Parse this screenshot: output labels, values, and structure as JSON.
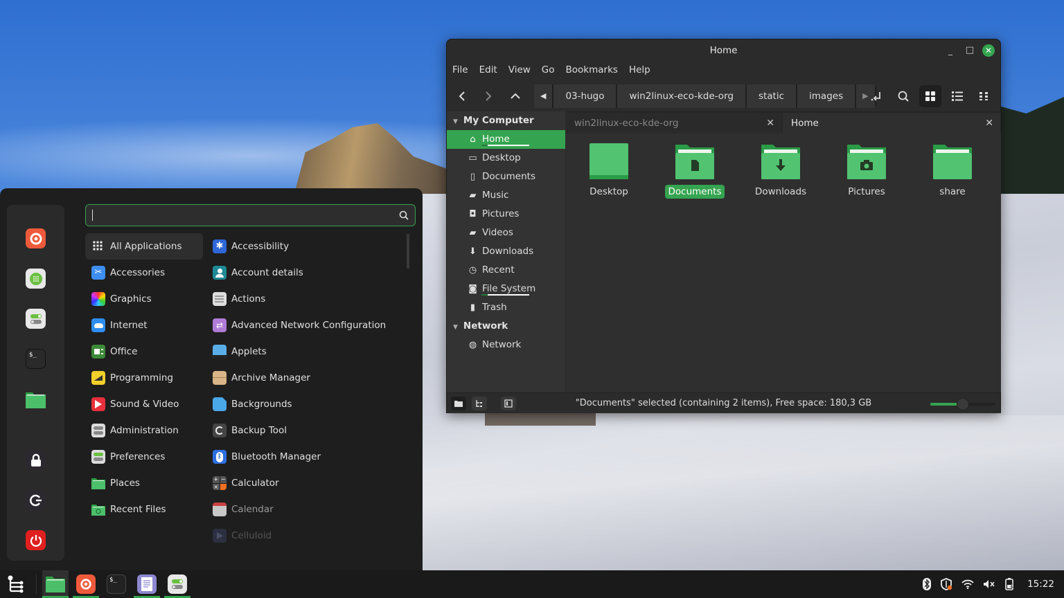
{
  "start_menu": {
    "search": {
      "value": "",
      "placeholder": ""
    },
    "favorites": [
      {
        "name": "firefox",
        "color": "#ee5a3b"
      },
      {
        "name": "software-manager",
        "color": "#e8e8e8"
      },
      {
        "name": "system-settings",
        "color": "#e8e8e8"
      },
      {
        "name": "terminal",
        "color": "#2a2a2a"
      },
      {
        "name": "files",
        "color": "#4cbf6a"
      },
      {
        "name": "lock-screen",
        "color": "#2b2830"
      },
      {
        "name": "logout",
        "color": "#2b2830"
      },
      {
        "name": "shutdown",
        "color": "#e0201e"
      }
    ],
    "categories": [
      {
        "label": "All Applications",
        "icon": "grid-icon",
        "color": "#2e2e2e",
        "selected": true
      },
      {
        "label": "Accessories",
        "icon": "scissors-icon",
        "color": "#3d8ef0"
      },
      {
        "label": "Graphics",
        "icon": "color-palette-icon",
        "color": "#c03fd0"
      },
      {
        "label": "Internet",
        "icon": "cloud-icon",
        "color": "#2e8ef0"
      },
      {
        "label": "Office",
        "icon": "office-icon",
        "color": "#3d8a38"
      },
      {
        "label": "Programming",
        "icon": "ruler-icon",
        "color": "#f2cf2a"
      },
      {
        "label": "Sound & Video",
        "icon": "play-icon",
        "color": "#e8303c"
      },
      {
        "label": "Administration",
        "icon": "toggles-icon",
        "color": "#dddddd"
      },
      {
        "label": "Preferences",
        "icon": "toggles-green-icon",
        "color": "#dddddd"
      },
      {
        "label": "Places",
        "icon": "folder-icon",
        "color": "#4cbf6a"
      },
      {
        "label": "Recent Files",
        "icon": "recent-folder-icon",
        "color": "#4cbf6a"
      }
    ],
    "applications": [
      {
        "label": "Accessibility",
        "icon": "accessibility-icon",
        "color": "#2f66d8"
      },
      {
        "label": "Account details",
        "icon": "user-icon",
        "color": "#1e8a96"
      },
      {
        "label": "Actions",
        "icon": "list-icon",
        "color": "#dedede"
      },
      {
        "label": "Advanced Network Configuration",
        "icon": "network-arrows-icon",
        "color": "#b07bd6"
      },
      {
        "label": "Applets",
        "icon": "applets-icon",
        "color": "#5aaee8"
      },
      {
        "label": "Archive Manager",
        "icon": "archive-icon",
        "color": "#d8b488"
      },
      {
        "label": "Backgrounds",
        "icon": "backgrounds-icon",
        "color": "#4aa8e8"
      },
      {
        "label": "Backup Tool",
        "icon": "backup-icon",
        "color": "#444444"
      },
      {
        "label": "Bluetooth Manager",
        "icon": "bluetooth-icon",
        "color": "#2e6ee0"
      },
      {
        "label": "Calculator",
        "icon": "calculator-icon",
        "color": "#555555"
      },
      {
        "label": "Calendar",
        "icon": "calendar-icon",
        "color": "#c8c8c8"
      },
      {
        "label": "Celluloid",
        "icon": "celluloid-icon",
        "color": "#2c2f40"
      }
    ]
  },
  "file_manager": {
    "title": "Home",
    "window_controls": {
      "minimize": "_",
      "maximize": "□",
      "close": "✕"
    },
    "menu": [
      "File",
      "Edit",
      "View",
      "Go",
      "Bookmarks",
      "Help"
    ],
    "path": [
      "03-hugo",
      "win2linux-eco-kde-org",
      "static",
      "images"
    ],
    "sidebar": {
      "sections": [
        {
          "title": "My Computer",
          "items": [
            {
              "label": "Home",
              "icon": "home-icon",
              "glyph": "⌂",
              "selected": true,
              "usage": 0.13
            },
            {
              "label": "Desktop",
              "icon": "desktop-icon",
              "glyph": "▭"
            },
            {
              "label": "Documents",
              "icon": "document-icon",
              "glyph": "▯"
            },
            {
              "label": "Music",
              "icon": "music-folder-icon",
              "glyph": "▰"
            },
            {
              "label": "Pictures",
              "icon": "camera-icon",
              "glyph": "◘"
            },
            {
              "label": "Videos",
              "icon": "video-folder-icon",
              "glyph": "▰"
            },
            {
              "label": "Downloads",
              "icon": "download-icon",
              "glyph": "⬇"
            },
            {
              "label": "Recent",
              "icon": "clock-icon",
              "glyph": "◷"
            },
            {
              "label": "File System",
              "icon": "drive-icon",
              "glyph": "◙",
              "usage": 0.13
            },
            {
              "label": "Trash",
              "icon": "trash-icon",
              "glyph": "▮"
            }
          ]
        },
        {
          "title": "Network",
          "items": [
            {
              "label": "Network",
              "icon": "globe-icon",
              "glyph": "◍"
            }
          ]
        }
      ]
    },
    "tabs": [
      {
        "label": "win2linux-eco-kde-org",
        "active": false
      },
      {
        "label": "Home",
        "active": true
      }
    ],
    "items": [
      {
        "label": "Desktop",
        "type": "desktop",
        "selected": false
      },
      {
        "label": "Documents",
        "type": "documents",
        "selected": true
      },
      {
        "label": "Downloads",
        "type": "downloads",
        "selected": false
      },
      {
        "label": "Pictures",
        "type": "pictures",
        "selected": false
      },
      {
        "label": "share",
        "type": "plain",
        "selected": false
      }
    ],
    "status": "\"Documents\" selected (containing 2 items), Free space: 180,3 GB",
    "zoom_level": 0.5,
    "accent": "#35a450"
  },
  "taskbar": {
    "apps": [
      {
        "name": "files",
        "active": true,
        "running": true
      },
      {
        "name": "firefox",
        "active": false,
        "running": true
      },
      {
        "name": "terminal",
        "active": false,
        "running": false
      },
      {
        "name": "text-editor",
        "active": false,
        "running": true
      },
      {
        "name": "system-settings",
        "active": false,
        "running": true
      }
    ],
    "tray": [
      "bluetooth-icon",
      "shield-update-icon",
      "wifi-icon",
      "volume-muted-icon",
      "battery-icon"
    ],
    "clock": "15:22"
  }
}
